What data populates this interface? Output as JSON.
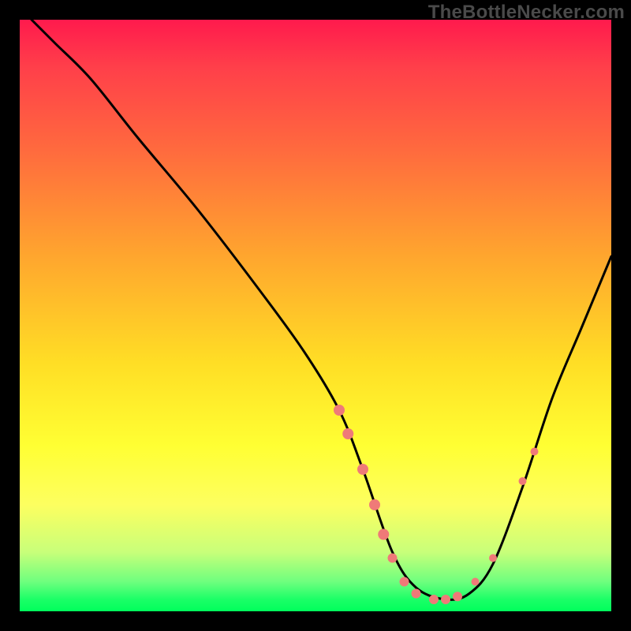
{
  "watermark": "TheBottleNecker.com",
  "chart_data": {
    "type": "line",
    "title": "",
    "xlabel": "",
    "ylabel": "",
    "xlim": [
      0,
      100
    ],
    "ylim": [
      0,
      100
    ],
    "grid": false,
    "series": [
      {
        "name": "curve",
        "x": [
          2,
          6,
          12,
          20,
          30,
          40,
          48,
          54,
          58,
          63,
          67,
          72,
          76,
          80,
          85,
          90,
          95,
          100
        ],
        "y": [
          100,
          96,
          90,
          80,
          68,
          55,
          44,
          34,
          24,
          10,
          4,
          2,
          3,
          8,
          21,
          36,
          48,
          60
        ]
      }
    ],
    "markers": [
      {
        "x": 54,
        "y": 34,
        "r": 7
      },
      {
        "x": 55.5,
        "y": 30,
        "r": 7
      },
      {
        "x": 58,
        "y": 24,
        "r": 7
      },
      {
        "x": 60,
        "y": 18,
        "r": 7
      },
      {
        "x": 61.5,
        "y": 13,
        "r": 7
      },
      {
        "x": 63,
        "y": 9,
        "r": 6
      },
      {
        "x": 65,
        "y": 5,
        "r": 6
      },
      {
        "x": 67,
        "y": 3,
        "r": 6
      },
      {
        "x": 70,
        "y": 2,
        "r": 6
      },
      {
        "x": 72,
        "y": 2,
        "r": 6
      },
      {
        "x": 74,
        "y": 2.5,
        "r": 6
      },
      {
        "x": 77,
        "y": 5,
        "r": 5
      },
      {
        "x": 80,
        "y": 9,
        "r": 5
      },
      {
        "x": 85,
        "y": 22,
        "r": 5
      },
      {
        "x": 87,
        "y": 27,
        "r": 5
      }
    ],
    "colors": {
      "curve": "#000000",
      "marker": "#ef7a78"
    }
  }
}
